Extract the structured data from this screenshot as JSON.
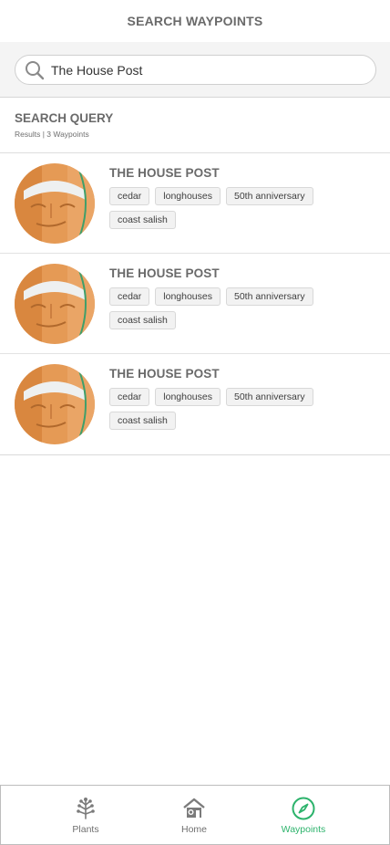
{
  "header": {
    "title": "SEARCH WAYPOINTS"
  },
  "search": {
    "value": "The House Post",
    "icon": "search-icon"
  },
  "query": {
    "title": "SEARCH QUERY",
    "subtitle": "Results | 3 Waypoints"
  },
  "results": [
    {
      "title": "THE HOUSE POST",
      "tags": [
        "cedar",
        "longhouses",
        "50th anniversary",
        "coast salish"
      ]
    },
    {
      "title": "THE HOUSE POST",
      "tags": [
        "cedar",
        "longhouses",
        "50th anniversary",
        "coast salish"
      ]
    },
    {
      "title": "THE HOUSE POST",
      "tags": [
        "cedar",
        "longhouses",
        "50th anniversary",
        "coast salish"
      ]
    }
  ],
  "tabs": [
    {
      "label": "Plants",
      "icon": "tree-icon",
      "active": false
    },
    {
      "label": "Home",
      "icon": "house-icon",
      "active": false
    },
    {
      "label": "Waypoints",
      "icon": "compass-icon",
      "active": true
    }
  ],
  "colors": {
    "accent": "#2db36c",
    "text": "#6a6a6a",
    "tag_bg": "#f2f2f2"
  }
}
